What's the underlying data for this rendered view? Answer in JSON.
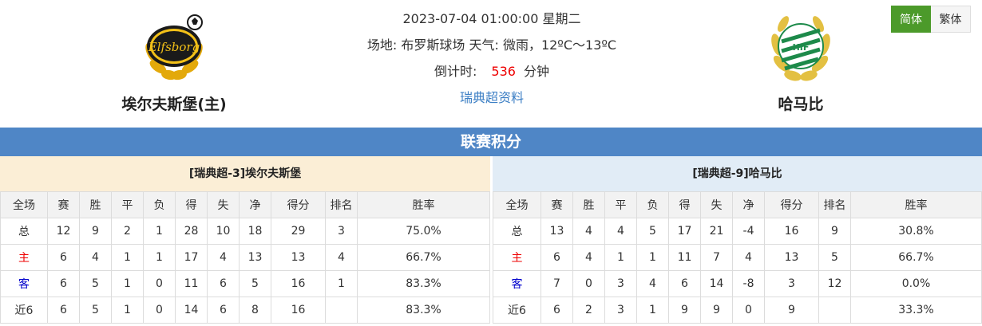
{
  "match": {
    "datetime": "2023-07-04 01:00:00 星期二",
    "venue_weather": "场地: 布罗斯球场 天气: 微雨，12ºC～13ºC",
    "countdown_label": "倒计时:",
    "countdown_value": "536",
    "countdown_unit": "分钟",
    "league_link": "瑞典超资料"
  },
  "home_team": {
    "name": "埃尔夫斯堡(主)",
    "logo_text": "Elfsborg",
    "logo_icon": "elfsborg-crest-icon"
  },
  "away_team": {
    "name": "哈马比",
    "logo_text": "HIF",
    "logo_icon": "hammarby-crest-icon"
  },
  "lang": {
    "simplified": "简体",
    "traditional": "繁体"
  },
  "section_title": "联赛积分",
  "columns": [
    "全场",
    "赛",
    "胜",
    "平",
    "负",
    "得",
    "失",
    "净",
    "得分",
    "排名",
    "胜率"
  ],
  "home_standings": {
    "title": "[瑞典超-3]埃尔夫斯堡",
    "rows": [
      [
        "总",
        "12",
        "9",
        "2",
        "1",
        "28",
        "10",
        "18",
        "29",
        "3",
        "75.0%"
      ],
      [
        "主",
        "6",
        "4",
        "1",
        "1",
        "17",
        "4",
        "13",
        "13",
        "4",
        "66.7%"
      ],
      [
        "客",
        "6",
        "5",
        "1",
        "0",
        "11",
        "6",
        "5",
        "16",
        "1",
        "83.3%"
      ],
      [
        "近6",
        "6",
        "5",
        "1",
        "0",
        "14",
        "6",
        "8",
        "16",
        "",
        "83.3%"
      ]
    ]
  },
  "away_standings": {
    "title": "[瑞典超-9]哈马比",
    "rows": [
      [
        "总",
        "13",
        "4",
        "4",
        "5",
        "17",
        "21",
        "-4",
        "16",
        "9",
        "30.8%"
      ],
      [
        "主",
        "6",
        "4",
        "1",
        "1",
        "11",
        "7",
        "4",
        "13",
        "5",
        "66.7%"
      ],
      [
        "客",
        "7",
        "0",
        "3",
        "4",
        "6",
        "14",
        "-8",
        "3",
        "12",
        "0.0%"
      ],
      [
        "近6",
        "6",
        "2",
        "3",
        "1",
        "9",
        "9",
        "0",
        "9",
        "",
        "33.3%"
      ]
    ]
  },
  "colors": {
    "accent": "#4f86c6",
    "home_header": "#fbeed6",
    "away_header": "#e1ecf6",
    "highlight_red": "#e00",
    "lang_active": "#4c9a2a"
  }
}
